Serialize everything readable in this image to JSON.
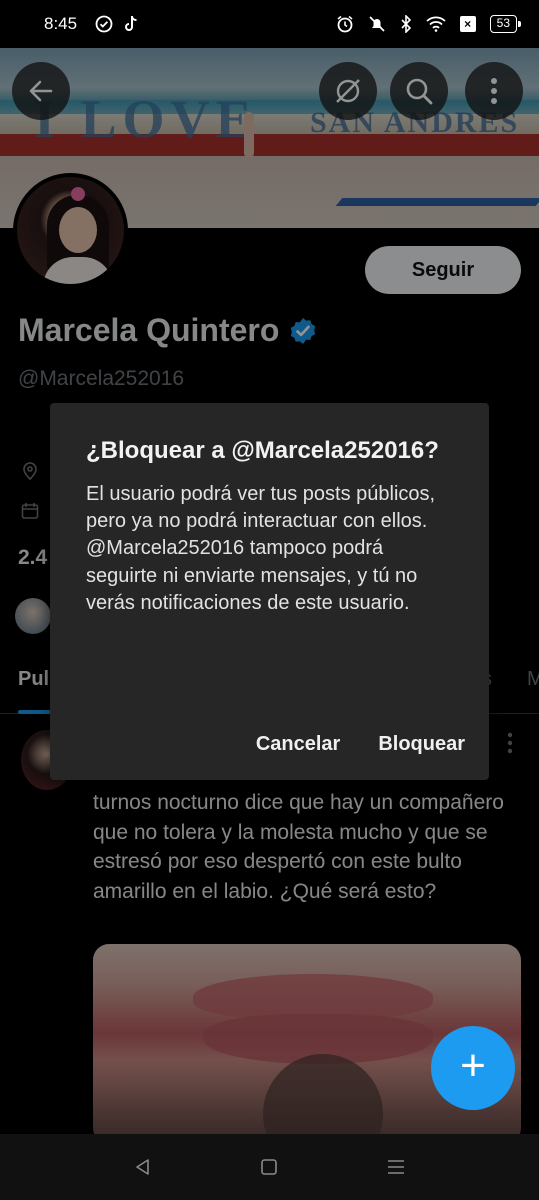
{
  "status_bar": {
    "time": "8:45",
    "battery": "53"
  },
  "profile": {
    "name": "Marcela Quintero",
    "handle": "@Marcela252016",
    "follow_label": "Seguir",
    "followers_partial": "2.4",
    "verified_color": "#1d9bf0"
  },
  "banner": {
    "sign_text_1": "I LOVE",
    "sign_text_2": "SAN ANDRES"
  },
  "tabs": {
    "active": "Pul",
    "partial_s": "s",
    "partial_m": "M"
  },
  "post": {
    "text": "turnos nocturno dice que hay un compañero que no tolera y la molesta mucho y que se estresó por eso despertó con este bulto amarillo en el labio. ¿Qué será esto?",
    "more_icon": "more-vertical-icon"
  },
  "dialog": {
    "title": "¿Bloquear a @Marcela252016?",
    "body": "El usuario podrá ver tus posts públicos, pero ya no podrá interactuar con ellos. @Marcela252016 tampoco podrá seguirte ni enviarte mensajes, y tú no verás notificaciones de este usuario.",
    "cancel_label": "Cancelar",
    "confirm_label": "Bloquear"
  },
  "fab_label": "+",
  "accent_color": "#1d9bf0"
}
